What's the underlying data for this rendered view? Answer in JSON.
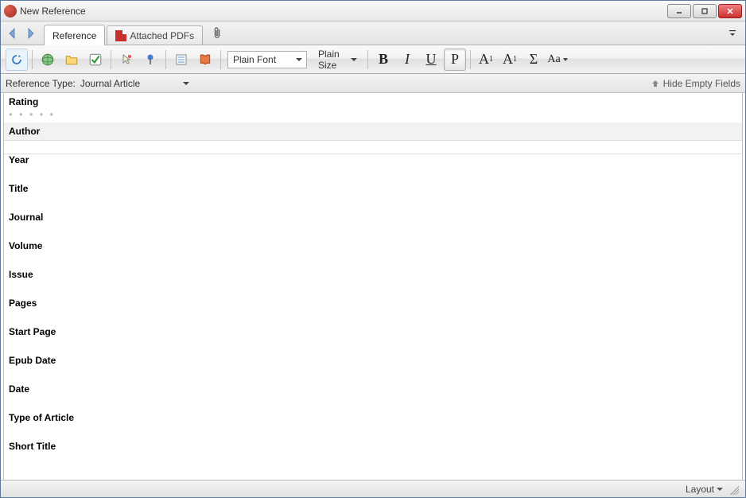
{
  "window": {
    "title": "New Reference"
  },
  "tabs": {
    "reference": "Reference",
    "attached_pdfs": "Attached PDFs"
  },
  "toolbar": {
    "font_label": "Plain Font",
    "size_label": "Plain Size",
    "bold": "B",
    "italic": "I",
    "underline": "U",
    "plain": "P",
    "sup_base": "A",
    "sup_exp": "1",
    "sub_base": "A",
    "sub_exp": "1",
    "symbol": "Σ",
    "case": "Aa"
  },
  "typebar": {
    "label": "Reference Type:",
    "value": "Journal Article",
    "hide_empty": "Hide Empty Fields"
  },
  "fields": [
    "Rating",
    "Author",
    "Year",
    "Title",
    "Journal",
    "Volume",
    "Issue",
    "Pages",
    "Start Page",
    "Epub Date",
    "Date",
    "Type of Article",
    "Short Title"
  ],
  "statusbar": {
    "layout": "Layout"
  }
}
